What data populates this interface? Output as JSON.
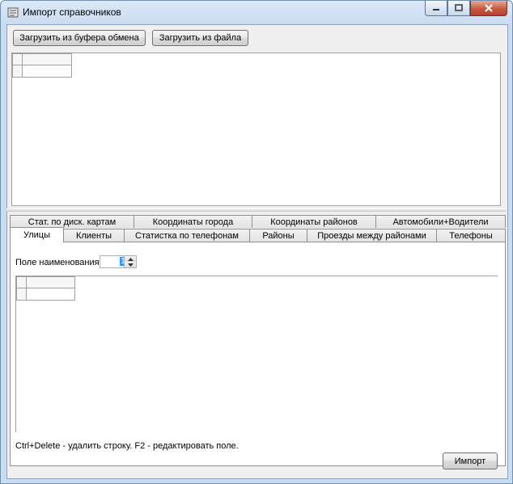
{
  "window": {
    "title": "Импорт справочников"
  },
  "toolbar": {
    "load_clipboard_label": "Загрузить из буфера обмена",
    "load_file_label": "Загрузить из файла"
  },
  "tabs_row1": [
    "Стат. по диск. картам",
    "Координаты города",
    "Координаты районов",
    "Автомобили+Водители"
  ],
  "tabs_row2": [
    "Улицы",
    "Клиенты",
    "Статистка по телефонам",
    "Районы",
    "Проезды между районами",
    "Телефоны"
  ],
  "active_tab": "Улицы",
  "streets_tab": {
    "name_field_label": "Поле наименования:",
    "name_field_value": "1",
    "hint_text": "Ctrl+Delete - удалить строку. F2 - редактировать поле.",
    "import_label": "Импорт"
  }
}
